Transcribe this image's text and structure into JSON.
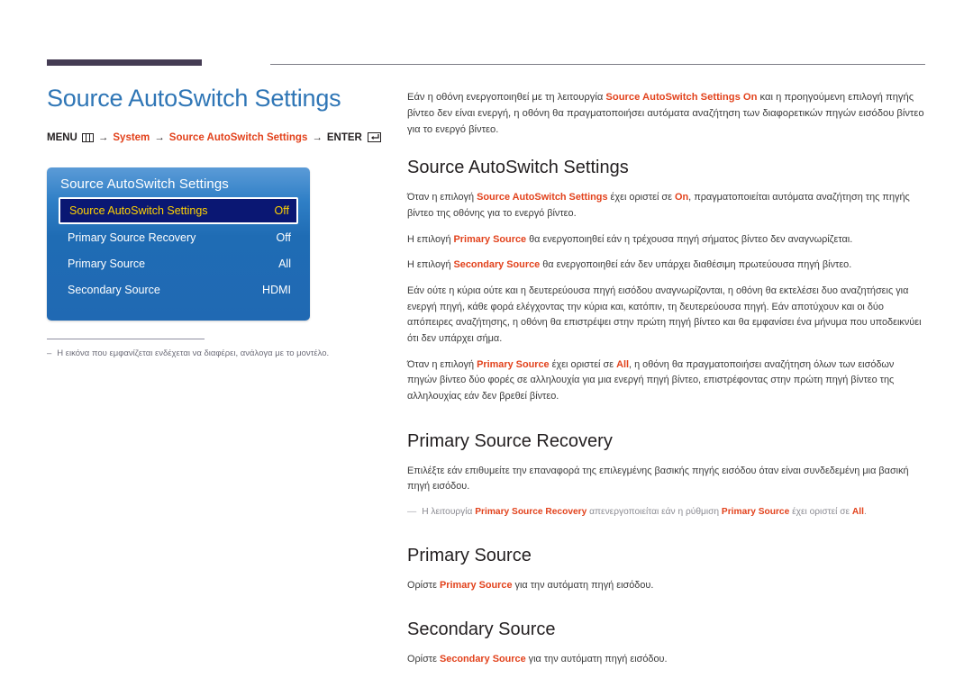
{
  "header": {
    "page_title": "Source AutoSwitch Settings",
    "breadcrumb": {
      "menu_label": "MENU",
      "menu_icon": "menu-grid-icon",
      "arrow": "→",
      "system_label": "System",
      "setting_label": "Source AutoSwitch Settings",
      "enter_label": "ENTER",
      "enter_icon": "enter-return-icon"
    }
  },
  "osd_panel": {
    "title": "Source AutoSwitch Settings",
    "rows": [
      {
        "label": "Source AutoSwitch Settings",
        "value": "Off",
        "selected": true
      },
      {
        "label": "Primary Source Recovery",
        "value": "Off",
        "selected": false
      },
      {
        "label": "Primary Source",
        "value": "All",
        "selected": false
      },
      {
        "label": "Secondary Source",
        "value": "HDMI",
        "selected": false
      }
    ]
  },
  "left_note": {
    "dash": "–",
    "text": "Η εικόνα που εμφανίζεται ενδέχεται να διαφέρει, ανάλογα με το μοντέλο."
  },
  "intro": {
    "p1_a": "Εάν η οθόνη ενεργοποιηθεί με τη λειτουργία ",
    "p1_kw": "Source AutoSwitch Settings On",
    "p1_b": " και η προηγούμενη επιλογή πηγής βίντεο δεν είναι ενεργή, η οθόνη θα πραγματοποιήσει αυτόματα αναζήτηση των διαφορετικών πηγών εισόδου βίντεο για το ενεργό βίντεο."
  },
  "section_autoswitch": {
    "heading": "Source AutoSwitch Settings",
    "p1_a": "Όταν η επιλογή ",
    "p1_kw1": "Source AutoSwitch Settings",
    "p1_b": " έχει οριστεί σε ",
    "p1_kw2": "On",
    "p1_c": ", πραγματοποιείται αυτόματα αναζήτηση της πηγής βίντεο της οθόνης για το ενεργό βίντεο.",
    "p2_a": "Η επιλογή ",
    "p2_kw": "Primary Source",
    "p2_b": " θα ενεργοποιηθεί εάν η τρέχουσα πηγή σήματος βίντεο δεν αναγνωρίζεται.",
    "p3_a": "Η επιλογή ",
    "p3_kw": "Secondary Source",
    "p3_b": " θα ενεργοποιηθεί εάν δεν υπάρχει διαθέσιμη πρωτεύουσα πηγή βίντεο.",
    "p4": "Εάν ούτε η κύρια ούτε και η δευτερεύουσα πηγή εισόδου αναγνωρίζονται, η οθόνη θα εκτελέσει δυο αναζητήσεις για ενεργή πηγή, κάθε φορά ελέγχοντας την κύρια και, κατόπιν, τη δευτερεύουσα πηγή. Εάν αποτύχουν και οι δύο απόπειρες αναζήτησης, η οθόνη θα επιστρέψει στην πρώτη πηγή βίντεο και θα εμφανίσει ένα μήνυμα που υποδεικνύει ότι δεν υπάρχει σήμα.",
    "p5_a": "Όταν η επιλογή ",
    "p5_kw1": "Primary Source",
    "p5_b": " έχει οριστεί σε ",
    "p5_kw2": "All",
    "p5_c": ", η οθόνη θα πραγματοποιήσει αναζήτηση όλων των εισόδων πηγών βίντεο δύο φορές σε αλληλουχία για μια ενεργή πηγή βίντεο, επιστρέφοντας στην πρώτη πηγή βίντεο της αλληλουχίας εάν δεν βρεθεί βίντεο."
  },
  "section_recovery": {
    "heading": "Primary Source Recovery",
    "p1": "Επιλέξτε εάν επιθυμείτε την επαναφορά της επιλεγμένης βασικής πηγής εισόδου όταν είναι συνδεδεμένη μια βασική πηγή εισόδου.",
    "note_dash": "—",
    "note_a": "Η λειτουργία ",
    "note_kw1": "Primary Source Recovery",
    "note_b": " απενεργοποιείται εάν η ρύθμιση ",
    "note_kw2": "Primary Source",
    "note_c": " έχει οριστεί σε ",
    "note_kw3": "All",
    "note_d": "."
  },
  "section_primary": {
    "heading": "Primary Source",
    "p1_a": "Ορίστε ",
    "p1_kw": "Primary Source",
    "p1_b": " για την αυτόματη πηγή εισόδου."
  },
  "section_secondary": {
    "heading": "Secondary Source",
    "p1_a": "Ορίστε ",
    "p1_kw": "Secondary Source",
    "p1_b": " για την αυτόματη πηγή εισόδου."
  },
  "colors": {
    "accent_blue": "#2f76b6",
    "keyword_orange": "#e2421c",
    "rule_purple": "#453c54",
    "osd_blue": "#2069b3",
    "osd_selected_bg": "#0a1773",
    "osd_selected_text": "#ffd200"
  }
}
